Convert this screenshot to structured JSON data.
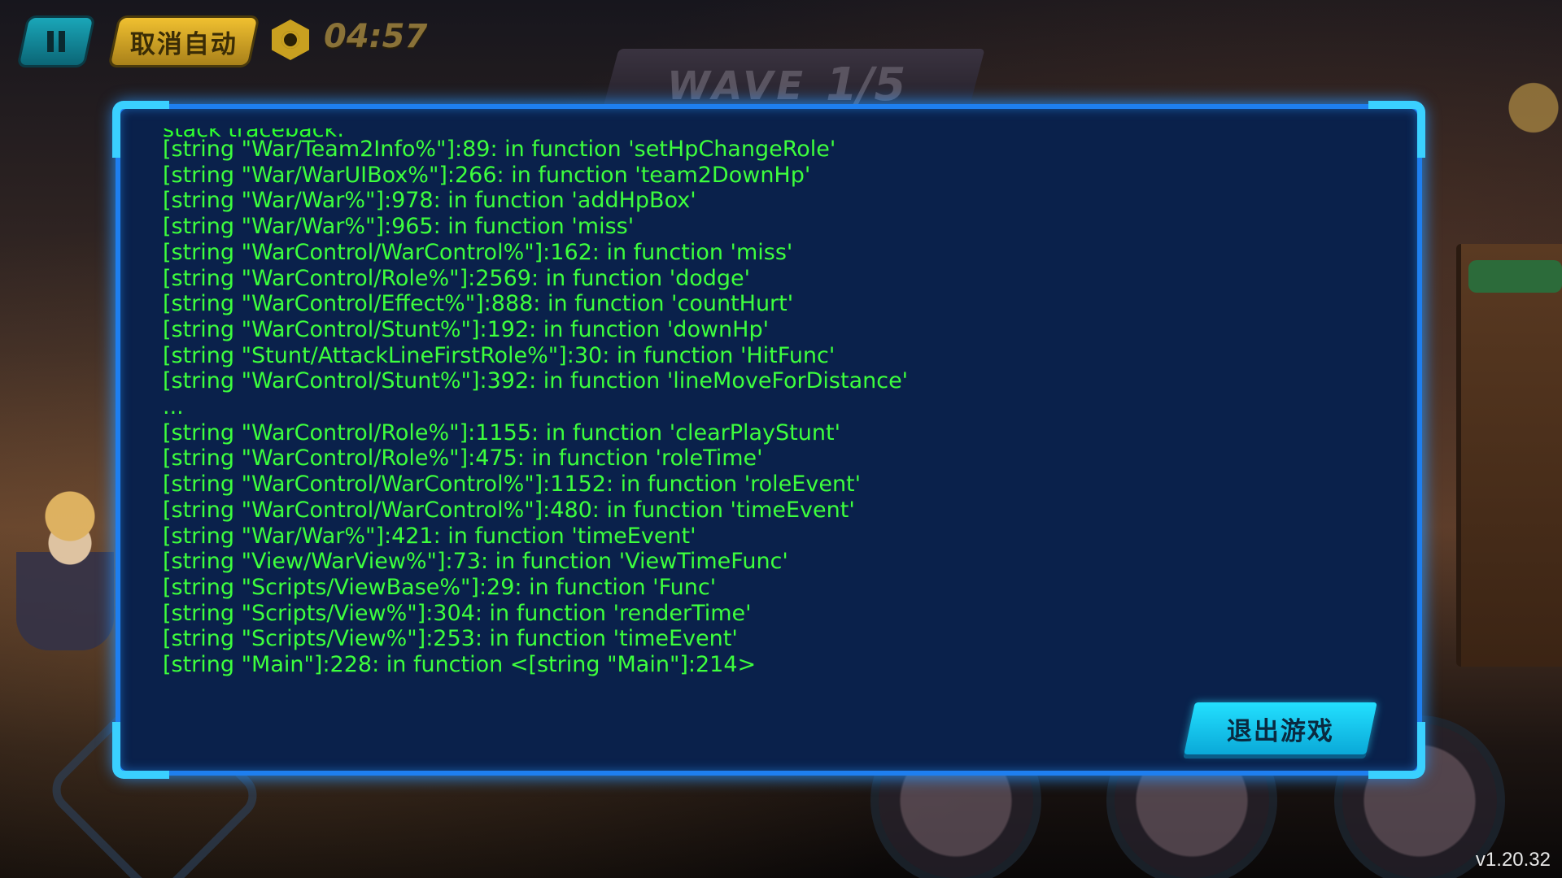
{
  "hud": {
    "auto_label": "取消自动",
    "timer": "04:57",
    "wave_label": "WAVE",
    "wave_count": "1/5"
  },
  "error_dialog": {
    "partial_header": "stack traceback:",
    "lines": [
      "[string \"War/Team2Info%\"]:89: in function 'setHpChangeRole'",
      "[string \"War/WarUIBox%\"]:266: in function 'team2DownHp'",
      "[string \"War/War%\"]:978: in function 'addHpBox'",
      "[string \"War/War%\"]:965: in function 'miss'",
      "[string \"WarControl/WarControl%\"]:162: in function 'miss'",
      "[string \"WarControl/Role%\"]:2569: in function 'dodge'",
      "[string \"WarControl/Effect%\"]:888: in function 'countHurt'",
      "[string \"WarControl/Stunt%\"]:192: in function 'downHp'",
      "[string \"Stunt/AttackLineFirstRole%\"]:30: in function 'HitFunc'",
      "[string \"WarControl/Stunt%\"]:392: in function 'lineMoveForDistance'",
      "...",
      "[string \"WarControl/Role%\"]:1155: in function 'clearPlayStunt'",
      "[string \"WarControl/Role%\"]:475: in function 'roleTime'",
      "[string \"WarControl/WarControl%\"]:1152: in function 'roleEvent'",
      "[string \"WarControl/WarControl%\"]:480: in function 'timeEvent'",
      "[string \"War/War%\"]:421: in function 'timeEvent'",
      "[string \"View/WarView%\"]:73: in function 'ViewTimeFunc'",
      "[string \"Scripts/ViewBase%\"]:29: in function 'Func'",
      "[string \"Scripts/View%\"]:304: in function 'renderTime'",
      "[string \"Scripts/View%\"]:253: in function 'timeEvent'",
      "[string \"Main\"]:228: in function <[string \"Main\"]:214>"
    ],
    "exit_label": "退出游戏"
  },
  "version": "v1.20.32",
  "icons": {
    "pause": "pause-icon",
    "clock": "clock-icon"
  },
  "colors": {
    "log_text": "#3dff3d",
    "dialog_bg": "#0a214b",
    "dialog_border": "#1e7ff0",
    "exit_button": "#23e0ff",
    "auto_button": "#f0c030"
  }
}
